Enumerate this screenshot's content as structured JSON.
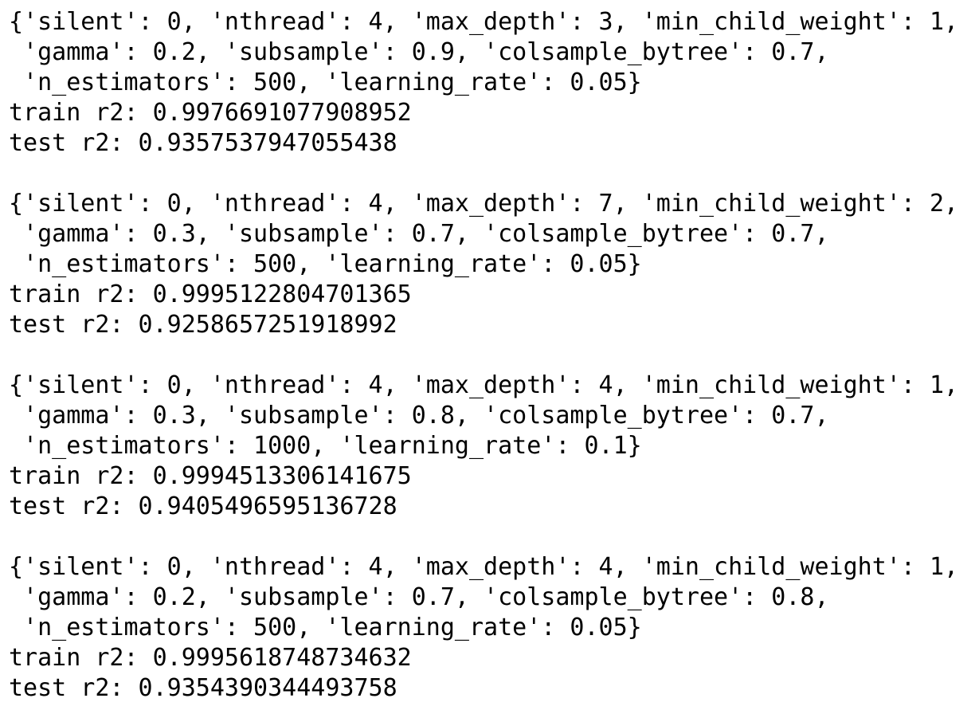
{
  "runs": [
    {
      "params_lines": [
        "{'silent': 0, 'nthread': 4, 'max_depth': 3, 'min_child_weight': 1,",
        " 'gamma': 0.2, 'subsample': 0.9, 'colsample_bytree': 0.7,",
        " 'n_estimators': 500, 'learning_rate': 0.05}"
      ],
      "train": "train r2: 0.9976691077908952",
      "test": "test r2: 0.9357537947055438"
    },
    {
      "params_lines": [
        "{'silent': 0, 'nthread': 4, 'max_depth': 7, 'min_child_weight': 2,",
        " 'gamma': 0.3, 'subsample': 0.7, 'colsample_bytree': 0.7,",
        " 'n_estimators': 500, 'learning_rate': 0.05}"
      ],
      "train": "train r2: 0.9995122804701365",
      "test": "test r2: 0.9258657251918992"
    },
    {
      "params_lines": [
        "{'silent': 0, 'nthread': 4, 'max_depth': 4, 'min_child_weight': 1,",
        " 'gamma': 0.3, 'subsample': 0.8, 'colsample_bytree': 0.7,",
        " 'n_estimators': 1000, 'learning_rate': 0.1}"
      ],
      "train": "train r2: 0.9994513306141675",
      "test": "test r2: 0.9405496595136728"
    },
    {
      "params_lines": [
        "{'silent': 0, 'nthread': 4, 'max_depth': 4, 'min_child_weight': 1,",
        " 'gamma': 0.2, 'subsample': 0.7, 'colsample_bytree': 0.8,",
        " 'n_estimators': 500, 'learning_rate': 0.05}"
      ],
      "train": "train r2: 0.9995618748734632",
      "test": "test r2: 0.9354390344493758"
    }
  ]
}
